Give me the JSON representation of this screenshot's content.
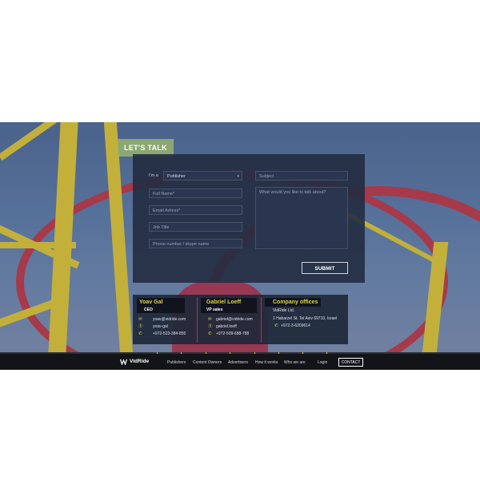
{
  "hero": {
    "badge": "LET'S TALK"
  },
  "form": {
    "im_a_label": "I'm a",
    "publisher_selected": "Publisher",
    "placeholders": {
      "full_name": "Full Name*",
      "email": "Email Adress*",
      "job_title": "Job Title",
      "phone": "Phone number / skype name",
      "subject": "Subject",
      "message": "What would you like to talk about?"
    },
    "submit_label": "SUBMIT"
  },
  "contacts": [
    {
      "title": "Yoav Gal",
      "role": "CEO",
      "email": "yoav@vidride.com",
      "skype": "yoav-gal",
      "phone": "+972-523-384-855"
    },
    {
      "title": "Gabriel Loeff",
      "role": "VP sales",
      "email": "gabriel@vidride.com",
      "skype": "gabriel.loeff",
      "phone": "+972-509-688-788"
    }
  ],
  "offices": {
    "title": "Company offices",
    "company": "VidRide Ltd.",
    "address": "1 Habarzel St. Tel Aviv 69710, Israel",
    "phone": "+972-3-6209614"
  },
  "footer": {
    "logo": "VidRide",
    "nav": [
      "Publishers",
      "Content Owners",
      "Advertisers",
      "How it works",
      "Who we are",
      "Login"
    ],
    "contact_label": "CONTACT"
  },
  "icons": {
    "email": "envelope-icon",
    "skype": "skype-icon",
    "phone": "phone-icon"
  },
  "colors": {
    "accent_yellow": "#d9d63f",
    "panel": "#222c40",
    "footer": "#131418"
  }
}
